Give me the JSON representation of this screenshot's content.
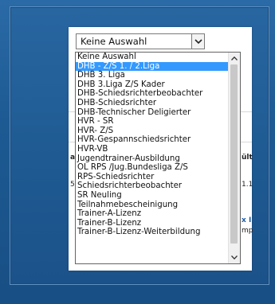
{
  "select": {
    "current_value": "Keine Auswahl",
    "expanded": true,
    "selected_index": 1,
    "options": [
      "Keine Auswahl",
      "DHB - Z/S 1. / 2.Liga",
      "DHB 3. Liga",
      "DHB 3.Liga Z/S Kader",
      "DHB-Schiedsrichterbeobachter",
      "DHB-Schiedsrichter",
      "DHB-Technischer Deligierter",
      "HVR - SR",
      "HVR- Z/S",
      "HVR-Gespannschiedsrichter",
      "HVR-VB",
      "Jugendtrainer-Ausbildung",
      "OL RPS /Jug.Bundesliga Z/S",
      "RPS-Schiedsrichter",
      "Schiedsrichterbeobachter",
      "SR Neuling",
      "Teilnahmebescheinigung",
      "Trainer-A-Lizenz",
      "Trainer-B-Lizenz",
      "Trainer-B-Lizenz-Weiterbildung"
    ]
  },
  "background_fragments": {
    "left_a": "a",
    "left_5": "5",
    "right_gult": "ült",
    "right_date": "1.1",
    "right_link": "x I",
    "right_mp": "mp"
  },
  "colors": {
    "page_bg": "#1f578d",
    "selected_option_bg": "#3399ff",
    "selected_option_text": "#ffffff",
    "link_color": "#1f5aa6"
  },
  "icons": {
    "select_arrow": "chevron-down-icon",
    "scroll_up": "triangle-up-icon",
    "scroll_down": "triangle-down-icon"
  }
}
